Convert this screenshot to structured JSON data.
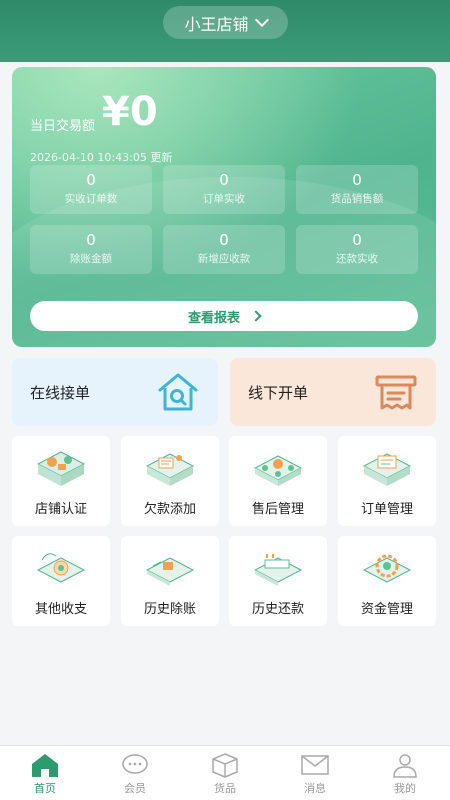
{
  "header": {
    "store_name": "小王店铺"
  },
  "summary": {
    "amount_label": "当日交易额",
    "amount_value": "¥0",
    "updated": "2026-04-10 10:43:05 更新",
    "stats": [
      {
        "value": "0",
        "label": "实收订单数"
      },
      {
        "value": "0",
        "label": "订单实收"
      },
      {
        "value": "0",
        "label": "货品销售额"
      },
      {
        "value": "0",
        "label": "除账金额"
      },
      {
        "value": "0",
        "label": "新增应收款"
      },
      {
        "value": "0",
        "label": "还款实收"
      }
    ],
    "report_button": "查看报表"
  },
  "quick_actions": {
    "online": "在线接单",
    "offline": "线下开单"
  },
  "grid": [
    {
      "label": "店铺认证",
      "icon": "shop-certify-icon"
    },
    {
      "label": "欠款添加",
      "icon": "debt-add-icon"
    },
    {
      "label": "售后管理",
      "icon": "after-sales-icon"
    },
    {
      "label": "订单管理",
      "icon": "order-manage-icon"
    },
    {
      "label": "其他收支",
      "icon": "other-income-icon"
    },
    {
      "label": "历史除账",
      "icon": "history-writeoff-icon"
    },
    {
      "label": "历史还款",
      "icon": "history-repay-icon"
    },
    {
      "label": "资金管理",
      "icon": "fund-manage-icon"
    }
  ],
  "tabs": [
    {
      "label": "首页",
      "icon": "home-icon",
      "active": true
    },
    {
      "label": "会员",
      "icon": "member-icon"
    },
    {
      "label": "货品",
      "icon": "goods-icon"
    },
    {
      "label": "消息",
      "icon": "message-icon"
    },
    {
      "label": "我的",
      "icon": "profile-icon"
    }
  ],
  "colors": {
    "brand": "#2e9b6e",
    "online_bg": "#e6f3fd",
    "offline_bg": "#fbe6da"
  }
}
